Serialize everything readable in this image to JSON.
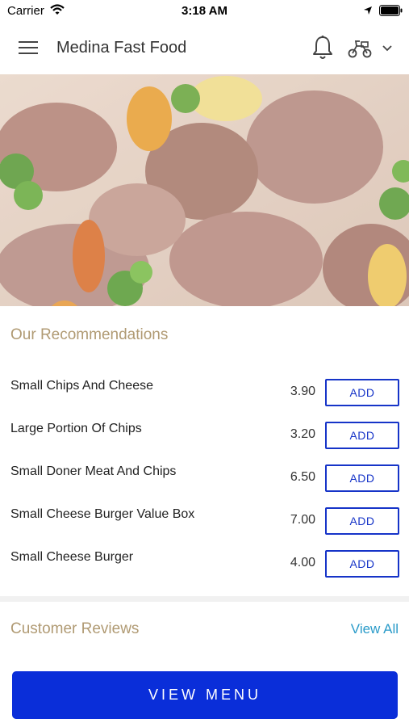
{
  "status_bar": {
    "carrier": "Carrier",
    "time": "3:18 AM",
    "icons": [
      "wifi-icon",
      "location-arrow-icon",
      "battery-icon"
    ]
  },
  "header": {
    "title": "Medina Fast Food",
    "icons": [
      "hamburger-menu-icon",
      "bell-icon",
      "delivery-scooter-icon",
      "chevron-down-icon"
    ]
  },
  "hero": {
    "description_icon": "food-photo"
  },
  "recommendations": {
    "title": "Our Recommendations",
    "items": [
      {
        "name": "Small Chips And Cheese",
        "price": "3.90",
        "button": "ADD"
      },
      {
        "name": "Large Portion Of Chips",
        "price": "3.20",
        "button": "ADD"
      },
      {
        "name": "Small Doner Meat And Chips",
        "price": "6.50",
        "button": "ADD"
      },
      {
        "name": "Small Cheese Burger Value Box",
        "price": "7.00",
        "button": "ADD"
      },
      {
        "name": "Small Cheese Burger",
        "price": "4.00",
        "button": "ADD"
      }
    ]
  },
  "reviews": {
    "title": "Customer Reviews",
    "view_all": "View All"
  },
  "footer": {
    "view_menu": "VIEW MENU"
  },
  "colors": {
    "accent_blue": "#0a2ed9",
    "add_border": "#1634c8",
    "section_title": "#b09a73",
    "link": "#2a9bc9"
  }
}
